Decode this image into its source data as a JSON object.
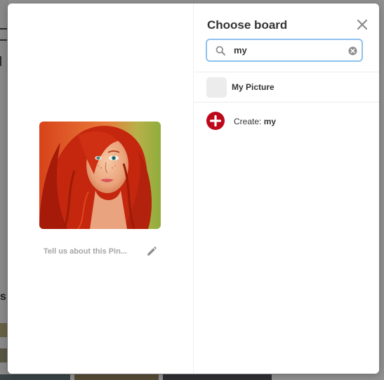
{
  "modal": {
    "title": "Choose board",
    "pin_description": "Tell us about this Pin...",
    "search": {
      "value": "my"
    },
    "boards": [
      {
        "label": "My Picture"
      }
    ],
    "create": {
      "prefix": "Create:",
      "name": "my"
    }
  },
  "background": {
    "partial_text": "s"
  },
  "icons": {
    "close": "close-icon",
    "search": "search-icon",
    "clear": "clear-input-icon",
    "edit": "pencil-icon",
    "create": "plus-circle-icon"
  },
  "colors": {
    "search_border": "#8fc1ee",
    "create_accent": "#bd081c",
    "title_text": "#333333",
    "muted_text": "#a5a5a5"
  }
}
